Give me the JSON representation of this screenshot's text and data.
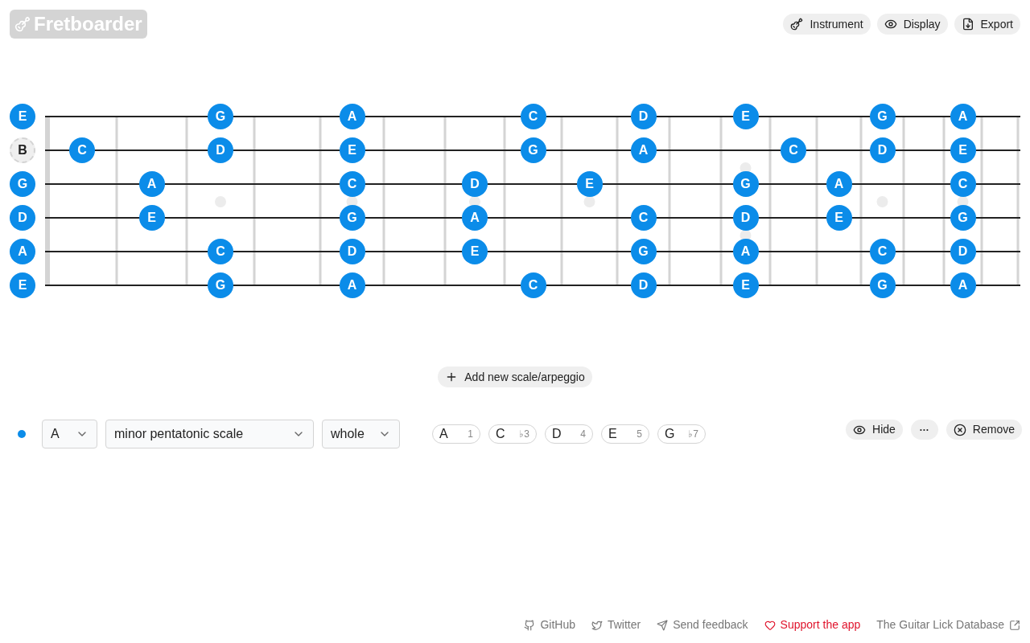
{
  "brand": {
    "title": "Fretboarder"
  },
  "toolbar": [
    {
      "kind": "instrument",
      "label": "Instrument"
    },
    {
      "kind": "display",
      "label": "Display"
    },
    {
      "kind": "export",
      "label": "Export"
    }
  ],
  "fretboard": {
    "strings": [
      {
        "open": "E",
        "in_scale": true,
        "frets": [
          {
            "kind": "empty"
          },
          {
            "kind": "empty"
          },
          {
            "kind": "note",
            "label": "G"
          },
          {
            "kind": "empty"
          },
          {
            "kind": "note",
            "label": "A"
          },
          {
            "kind": "empty"
          },
          {
            "kind": "empty"
          },
          {
            "kind": "note",
            "label": "C"
          },
          {
            "kind": "empty"
          },
          {
            "kind": "note",
            "label": "D"
          },
          {
            "kind": "empty"
          },
          {
            "kind": "note",
            "label": "E"
          },
          {
            "kind": "empty"
          },
          {
            "kind": "empty"
          },
          {
            "kind": "note",
            "label": "G"
          },
          {
            "kind": "empty"
          },
          {
            "kind": "note",
            "label": "A"
          }
        ]
      },
      {
        "open": "B",
        "in_scale": false,
        "frets": [
          {
            "kind": "note",
            "label": "C"
          },
          {
            "kind": "empty"
          },
          {
            "kind": "note",
            "label": "D"
          },
          {
            "kind": "empty"
          },
          {
            "kind": "note",
            "label": "E"
          },
          {
            "kind": "empty"
          },
          {
            "kind": "empty"
          },
          {
            "kind": "note",
            "label": "G"
          },
          {
            "kind": "empty"
          },
          {
            "kind": "note",
            "label": "A"
          },
          {
            "kind": "empty"
          },
          {
            "kind": "empty"
          },
          {
            "kind": "note",
            "label": "C"
          },
          {
            "kind": "empty"
          },
          {
            "kind": "note",
            "label": "D"
          },
          {
            "kind": "empty"
          },
          {
            "kind": "note",
            "label": "E"
          }
        ]
      },
      {
        "open": "G",
        "in_scale": true,
        "frets": [
          {
            "kind": "empty"
          },
          {
            "kind": "note",
            "label": "A"
          },
          {
            "kind": "empty"
          },
          {
            "kind": "empty"
          },
          {
            "kind": "note",
            "label": "C"
          },
          {
            "kind": "empty"
          },
          {
            "kind": "note",
            "label": "D"
          },
          {
            "kind": "empty"
          },
          {
            "kind": "note",
            "label": "E"
          },
          {
            "kind": "empty"
          },
          {
            "kind": "empty"
          },
          {
            "kind": "note",
            "label": "G"
          },
          {
            "kind": "empty"
          },
          {
            "kind": "note",
            "label": "A"
          },
          {
            "kind": "empty"
          },
          {
            "kind": "empty"
          },
          {
            "kind": "note",
            "label": "C"
          }
        ]
      },
      {
        "open": "D",
        "in_scale": true,
        "frets": [
          {
            "kind": "empty"
          },
          {
            "kind": "note",
            "label": "E"
          },
          {
            "kind": "empty"
          },
          {
            "kind": "empty"
          },
          {
            "kind": "note",
            "label": "G"
          },
          {
            "kind": "empty"
          },
          {
            "kind": "note",
            "label": "A"
          },
          {
            "kind": "empty"
          },
          {
            "kind": "empty"
          },
          {
            "kind": "note",
            "label": "C"
          },
          {
            "kind": "empty"
          },
          {
            "kind": "note",
            "label": "D"
          },
          {
            "kind": "empty"
          },
          {
            "kind": "note",
            "label": "E"
          },
          {
            "kind": "empty"
          },
          {
            "kind": "empty"
          },
          {
            "kind": "note",
            "label": "G"
          }
        ]
      },
      {
        "open": "A",
        "in_scale": true,
        "frets": [
          {
            "kind": "empty"
          },
          {
            "kind": "empty"
          },
          {
            "kind": "note",
            "label": "C"
          },
          {
            "kind": "empty"
          },
          {
            "kind": "note",
            "label": "D"
          },
          {
            "kind": "empty"
          },
          {
            "kind": "note",
            "label": "E"
          },
          {
            "kind": "empty"
          },
          {
            "kind": "empty"
          },
          {
            "kind": "note",
            "label": "G"
          },
          {
            "kind": "empty"
          },
          {
            "kind": "note",
            "label": "A"
          },
          {
            "kind": "empty"
          },
          {
            "kind": "empty"
          },
          {
            "kind": "note",
            "label": "C"
          },
          {
            "kind": "empty"
          },
          {
            "kind": "note",
            "label": "D"
          }
        ]
      },
      {
        "open": "E",
        "in_scale": true,
        "frets": [
          {
            "kind": "empty"
          },
          {
            "kind": "empty"
          },
          {
            "kind": "note",
            "label": "G"
          },
          {
            "kind": "empty"
          },
          {
            "kind": "note",
            "label": "A"
          },
          {
            "kind": "empty"
          },
          {
            "kind": "empty"
          },
          {
            "kind": "note",
            "label": "C"
          },
          {
            "kind": "empty"
          },
          {
            "kind": "note",
            "label": "D"
          },
          {
            "kind": "empty"
          },
          {
            "kind": "note",
            "label": "E"
          },
          {
            "kind": "empty"
          },
          {
            "kind": "empty"
          },
          {
            "kind": "note",
            "label": "G"
          },
          {
            "kind": "empty"
          },
          {
            "kind": "note",
            "label": "A"
          }
        ]
      }
    ]
  },
  "add_button": {
    "label": "Add new scale/arpeggio"
  },
  "scale": {
    "color": "#0b8ce9",
    "root": "A",
    "type": "minor pentatonic scale",
    "position": "whole",
    "intervals": [
      {
        "note": "A",
        "degree": "1"
      },
      {
        "note": "C",
        "degree": "♭3"
      },
      {
        "note": "D",
        "degree": "4"
      },
      {
        "note": "E",
        "degree": "5"
      },
      {
        "note": "G",
        "degree": "♭7"
      }
    ],
    "actions": [
      {
        "kind": "hide",
        "label": "Hide"
      },
      {
        "kind": "more",
        "label": "···"
      },
      {
        "kind": "remove",
        "label": "Remove"
      }
    ]
  },
  "footer": [
    {
      "kind": "github",
      "label": "GitHub",
      "highlight": false
    },
    {
      "kind": "twitter",
      "label": "Twitter",
      "highlight": false
    },
    {
      "kind": "feedback",
      "label": "Send feedback",
      "highlight": false
    },
    {
      "kind": "support",
      "label": "Support the app",
      "highlight": true
    },
    {
      "kind": "external",
      "label": "The Guitar Lick Database",
      "highlight": false
    }
  ]
}
